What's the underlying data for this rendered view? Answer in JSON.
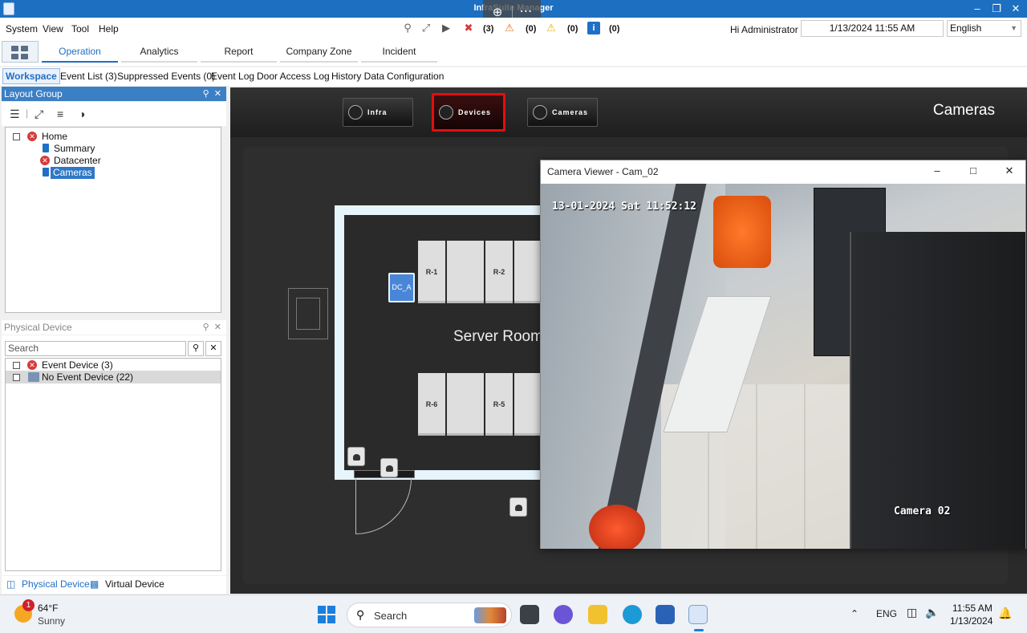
{
  "window": {
    "title": "InfraSuite Manager"
  },
  "menubar": {
    "items": [
      "System",
      "View",
      "Tool",
      "Help"
    ],
    "alerts": {
      "critical": "(3)",
      "warning_orange": "(0)",
      "warning_yellow": "(0)",
      "info": "(0)"
    },
    "greeting": "Hi Administrator",
    "datetime": "1/13/2024 11:55 AM",
    "language": "English"
  },
  "tabs": [
    "Operation",
    "Analytics",
    "Report",
    "Company Zone",
    "Incident"
  ],
  "subtabs": [
    "Workspace",
    "Event List (3)",
    "Suppressed Events (0)",
    "Event Log",
    "Door Access Log",
    "History Data",
    "Configuration"
  ],
  "layout_group": {
    "title": "Layout Group",
    "tree": {
      "home": "Home",
      "summary": "Summary",
      "datacenter": "Datacenter",
      "cameras": "Cameras"
    }
  },
  "physical_device": {
    "title": "Physical Device",
    "search_placeholder": "Search",
    "items": [
      "Event Device (3)",
      "No Event Device (22)"
    ],
    "bottom_tabs": [
      "Physical Device",
      "Virtual Device"
    ]
  },
  "main": {
    "nav": [
      "Infra",
      "Devices",
      "Cameras"
    ],
    "page_label": "Cameras",
    "room_label": "Server Room",
    "dc_label": "DC_A",
    "racks_top": [
      "R-1",
      "",
      "R-2",
      ""
    ],
    "racks_bottom": [
      "R-6",
      "",
      "R-5",
      ""
    ]
  },
  "camera_window": {
    "title": "Camera Viewer - Cam_02",
    "timestamp": "13-01-2024 Sat 11:52:12",
    "camera_name": "Camera 02"
  },
  "taskbar": {
    "weather_temp": "64°F",
    "weather_desc": "Sunny",
    "weather_badge": "1",
    "search_label": "Search",
    "lang": "ENG",
    "time": "11:55 AM",
    "date": "1/13/2024"
  }
}
